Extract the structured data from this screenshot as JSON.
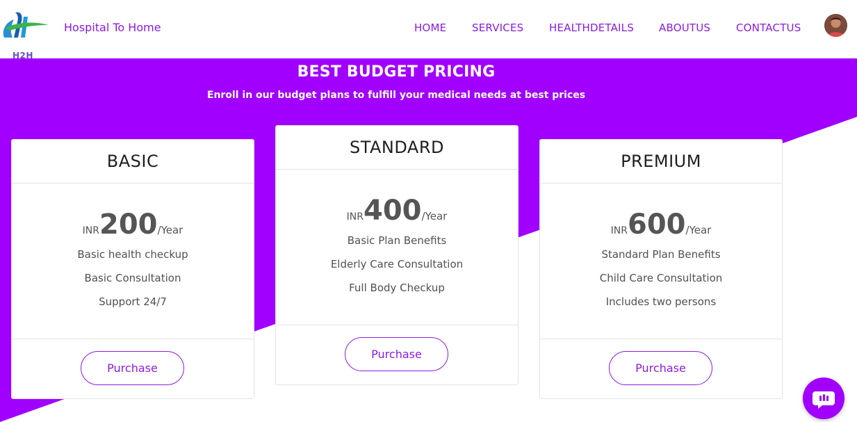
{
  "header": {
    "logo_text": "H2H",
    "brand": "Hospital To Home",
    "nav": [
      "HOME",
      "SERVICES",
      "HEALTHDETAILS",
      "ABOUTUS",
      "CONTACTUS"
    ]
  },
  "hero": {
    "title": "BEST BUDGET PRICING",
    "subtitle": "Enroll in our budget plans to fulfill your medical needs at best prices"
  },
  "plans": [
    {
      "name": "BASIC",
      "currency": "INR",
      "amount": "200",
      "period": "/Year",
      "features": [
        "Basic health checkup",
        "Basic Consultation",
        "Support 24/7"
      ],
      "button": "Purchase"
    },
    {
      "name": "STANDARD",
      "currency": "INR",
      "amount": "400",
      "period": "/Year",
      "features": [
        "Basic Plan Benefits",
        "Elderly Care Consultation",
        "Full Body Checkup"
      ],
      "button": "Purchase"
    },
    {
      "name": "PREMIUM",
      "currency": "INR",
      "amount": "600",
      "period": "/Year",
      "features": [
        "Standard Plan Benefits",
        "Child Care Consultation",
        "Includes two persons"
      ],
      "button": "Purchase"
    }
  ],
  "colors": {
    "accent": "#a100ff",
    "text_accent": "#8a1be2",
    "heading": "#1e1e1e"
  },
  "chat_icon": "chat-bubble-icon"
}
